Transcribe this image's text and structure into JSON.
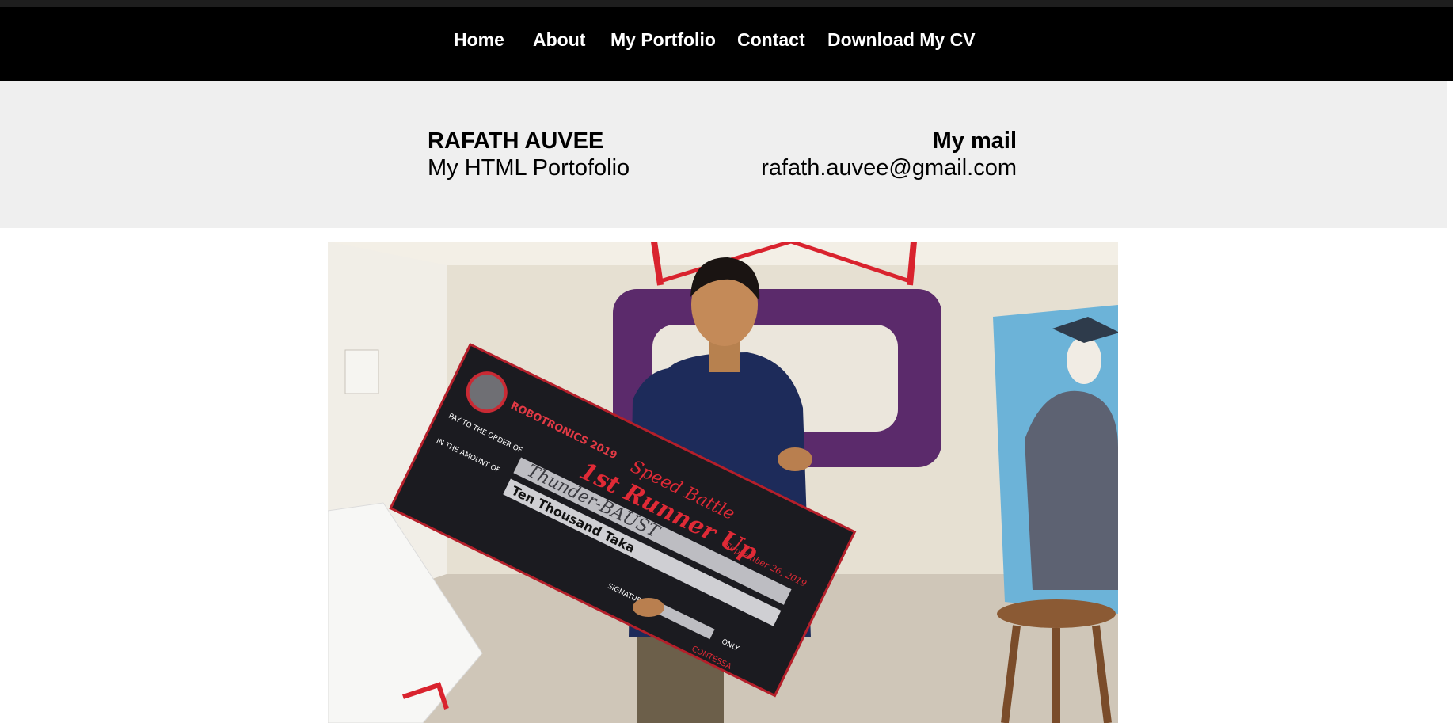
{
  "nav": {
    "items": [
      "Home",
      "About",
      "My Portfolio",
      "Contact",
      "Download My CV"
    ]
  },
  "header": {
    "name": "RAFATH AUVEE",
    "subtitle": "My HTML Portofolio",
    "mail_heading": "My mail",
    "email": "rafath.auvee@gmail.com"
  },
  "photo": {
    "check_brand": "ROBOTRONICS 2019",
    "check_title_1": "Speed Battle",
    "check_title_2": "1st Runner Up",
    "pay_to": "PAY TO THE ORDER OF",
    "in_amount": "IN THE AMOUNT OF",
    "payee": "Thunder-BAUST",
    "amount": "Ten Thousand Taka",
    "date": "September 26, 2019",
    "signature": "SIGNATURE",
    "only": "ONLY",
    "sponsor": "CONTESSA"
  }
}
